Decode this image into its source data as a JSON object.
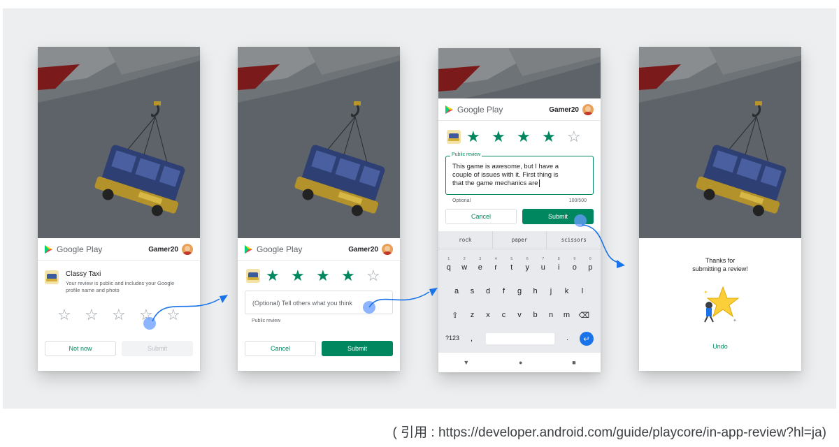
{
  "brand": {
    "name": "Google Play",
    "accent": "#01875f"
  },
  "user": {
    "name": "Gamer20"
  },
  "screen1": {
    "app_name": "Classy Taxi",
    "description_line1": "Your review is public and includes your Google",
    "description_line2": "profile name and photo",
    "rating": 0,
    "stars": [
      "☆",
      "☆",
      "☆",
      "☆",
      "☆"
    ],
    "not_now": "Not now",
    "submit": "Submit"
  },
  "screen2": {
    "rating": 4,
    "stars": [
      "★",
      "★",
      "★",
      "★",
      "☆"
    ],
    "placeholder": "(Optional) Tell others what you think",
    "field_hint": "Public review",
    "cancel": "Cancel",
    "submit": "Submit"
  },
  "screen3": {
    "rating": 4,
    "stars": [
      "★",
      "★",
      "★",
      "★",
      "☆"
    ],
    "field_label": "Public review",
    "review_line1": "This game is awesome, but I have a",
    "review_line2": "couple of issues with it. First thing is",
    "review_line3": "that the game mechanics are",
    "optional": "Optional",
    "counter": "100/500",
    "cancel": "Cancel",
    "submit": "Submit",
    "keyboard": {
      "suggestions": [
        "rock",
        "paper",
        "scissors"
      ],
      "digits": [
        "1",
        "2",
        "3",
        "4",
        "5",
        "6",
        "7",
        "8",
        "9",
        "0"
      ],
      "row1": [
        "q",
        "w",
        "e",
        "r",
        "t",
        "y",
        "u",
        "i",
        "o",
        "p"
      ],
      "row2": [
        "a",
        "s",
        "d",
        "f",
        "g",
        "h",
        "j",
        "k",
        "l"
      ],
      "row3": [
        "⇧",
        "z",
        "x",
        "c",
        "v",
        "b",
        "n",
        "m",
        "⌫"
      ],
      "symbols_key": "?123",
      "comma": ",",
      "period": ".",
      "enter": "↵",
      "nav": [
        "▼",
        "●",
        "■"
      ]
    }
  },
  "screen4": {
    "thanks_line1": "Thanks for",
    "thanks_line2": "submitting a review!",
    "undo": "Undo"
  },
  "caption": "( 引用 : https://developer.android.com/guide/playcore/in-app-review?hl=ja)"
}
